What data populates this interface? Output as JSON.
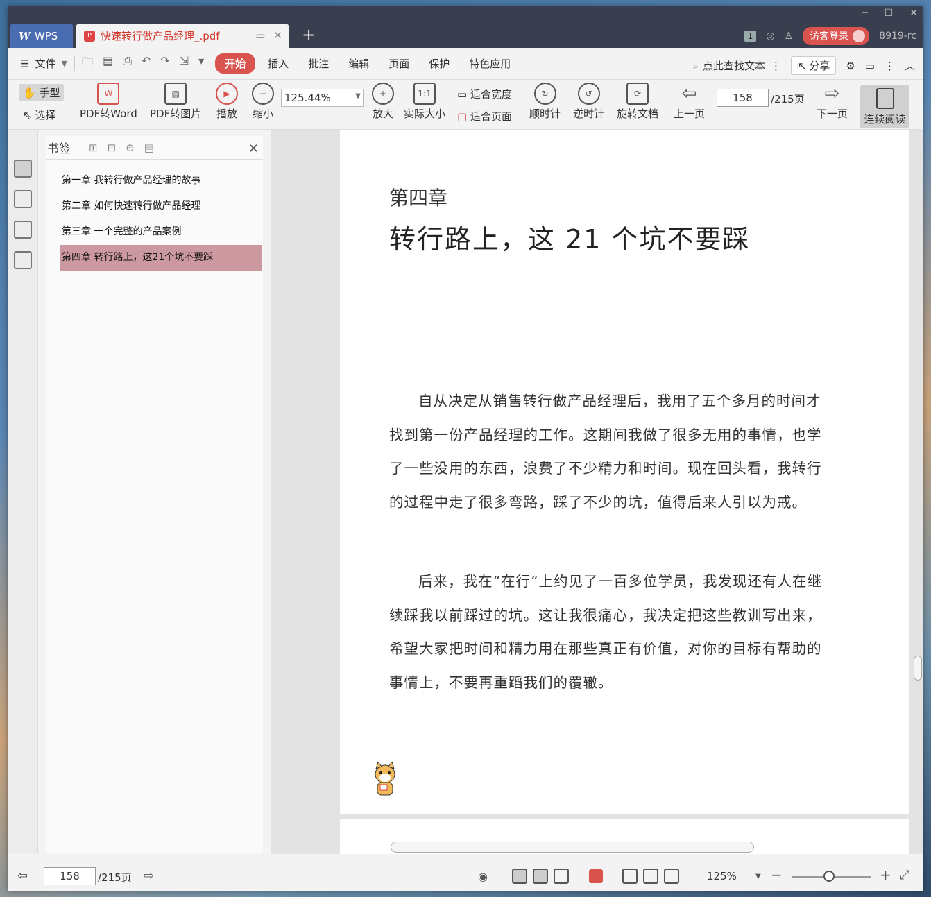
{
  "titlebar": {
    "wps_tab": "WPS",
    "doc_tab": "快速转行做产品经理_.pdf",
    "badge": "1",
    "login": "访客登录",
    "user": "8919-rc"
  },
  "menubar": {
    "file": "文件",
    "items": [
      "开始",
      "插入",
      "批注",
      "编辑",
      "页面",
      "保护",
      "特色应用"
    ],
    "search": "点此查找文本",
    "share": "分享"
  },
  "ribbon": {
    "hand": "手型",
    "select": "选择",
    "pdf_word": "PDF转Word",
    "pdf_img": "PDF转图片",
    "play": "播放",
    "zoom_out": "缩小",
    "zoom_value": "125.44%",
    "zoom_in": "放大",
    "actual": "实际大小",
    "fit_width": "适合宽度",
    "fit_page": "适合页面",
    "cw": "顺时针",
    "ccw": "逆时针",
    "rotate": "旋转文档",
    "prev": "上一页",
    "page": "158",
    "total": "/215页",
    "next": "下一页",
    "continuous": "连续阅读"
  },
  "bookmarks": {
    "title": "书签",
    "items": [
      "第一章 我转行做产品经理的故事",
      "第二章 如何快速转行做产品经理",
      "第三章 一个完整的产品案例",
      "第四章 转行路上，这21个坑不要踩"
    ]
  },
  "page": {
    "chapter": "第四章",
    "title": "转行路上，这 21 个坑不要踩",
    "p1": "自从决定从销售转行做产品经理后，我用了五个多月的时间才找到第一份产品经理的工作。这期间我做了很多无用的事情，也学了一些没用的东西，浪费了不少精力和时间。现在回头看，我转行的过程中走了很多弯路，踩了不少的坑，值得后来人引以为戒。",
    "p2": "后来，我在“在行”上约见了一百多位学员，我发现还有人在继续踩我以前踩过的坑。这让我很痛心，我决定把这些教训写出来，希望大家把时间和精力用在那些真正有价值，对你的目标有帮助的事情上，不要再重蹈我们的覆辙。"
  },
  "statusbar": {
    "page": "158",
    "total": "/215页",
    "zoom": "125%"
  }
}
